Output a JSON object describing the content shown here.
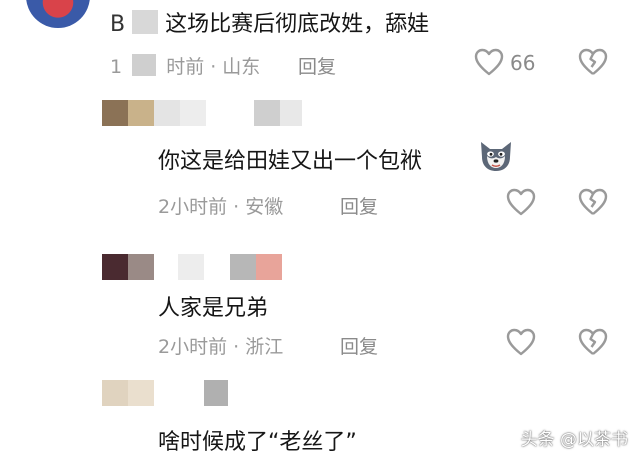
{
  "comments": [
    {
      "text": "这场比赛后彻底改姓，舔娃",
      "text_prefix": "B",
      "meta": "时前 · 山东",
      "meta_prefix": "1",
      "reply": "回复",
      "like_count": "66"
    },
    {
      "text": "你这是给田娃又出一个包袱",
      "meta": "2小时前 · 安徽",
      "reply": "回复"
    },
    {
      "text": "人家是兄弟",
      "meta": "2小时前 · 浙江",
      "reply": "回复"
    },
    {
      "text": "啥时候成了“老丝了”"
    }
  ],
  "watermark": "头条 @以茶书",
  "colors": {
    "like_outline": "#9a9a9a",
    "text": "#161616",
    "meta": "#9a9a9a"
  },
  "icons": {
    "like": "heart-outline-icon",
    "dislike": "broken-heart-icon",
    "emoji": "wolf-emoji-icon"
  }
}
